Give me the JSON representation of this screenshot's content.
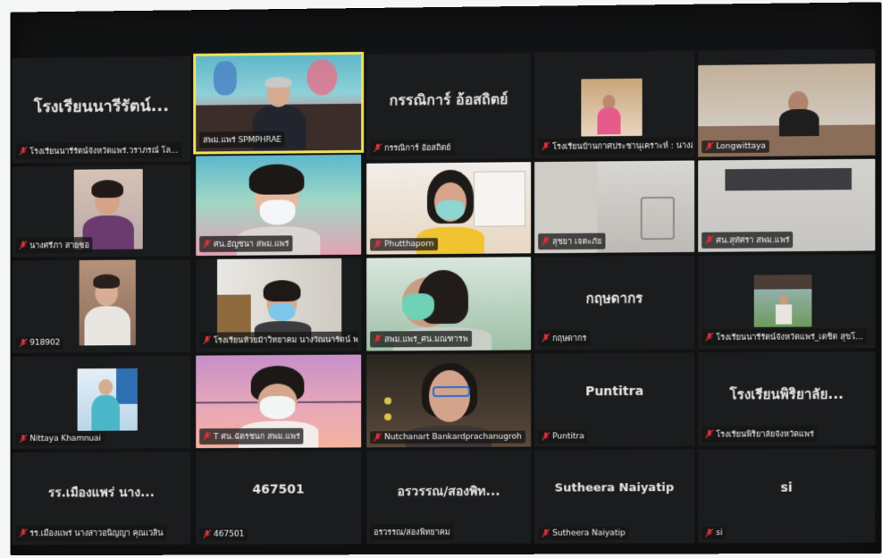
{
  "meeting": {
    "tiles": [
      {
        "id": "t1",
        "display_name": "โรงเรียนนารีรัตน์...",
        "label": "โรงเรียนนารีรัตน์จังหวัดแพร่.วราภรณ์ โล...",
        "muted": true
      },
      {
        "id": "t2",
        "display_name": "",
        "label": "สพม.แพร่ SPMPHRAE",
        "muted": false
      },
      {
        "id": "t3",
        "display_name": "กรรณิการ์ อ้อสถิตย์",
        "label": "กรรณิการ์ อ้อสถิตย์",
        "muted": true
      },
      {
        "id": "t4",
        "display_name": "",
        "label": "โรงเรียนบ้านกาศประชานุเคราะห์ : นางสา...",
        "muted": true
      },
      {
        "id": "t5",
        "display_name": "",
        "label": "Longwittaya",
        "muted": true
      },
      {
        "id": "t6",
        "display_name": "",
        "label": "นางศรีภา สายซอ",
        "muted": true
      },
      {
        "id": "t7",
        "display_name": "",
        "label": "ศน.อัญชนา สพม.แพร่",
        "muted": true
      },
      {
        "id": "t8",
        "display_name": "",
        "label": "Phutthaporn",
        "muted": true
      },
      {
        "id": "t9",
        "display_name": "",
        "label": "สุชยา เจตะภัย",
        "muted": true
      },
      {
        "id": "t10",
        "display_name": "",
        "label": "ศน.สุทัศรา สพม.แพร่",
        "muted": true
      },
      {
        "id": "t11",
        "display_name": "",
        "label": "918902",
        "muted": true
      },
      {
        "id": "t12",
        "display_name": "",
        "label": "โรงเรียนห้วยม้าวิทยาคม นางวัณนารัตน์ พ...",
        "muted": true
      },
      {
        "id": "t13",
        "display_name": "",
        "label": "สพม.แพร่_ศน.มณฑารพ",
        "muted": true
      },
      {
        "id": "t14",
        "display_name": "กฤษดากร",
        "label": "กฤษดากร",
        "muted": true
      },
      {
        "id": "t15",
        "display_name": "",
        "label": "โรงเรียนนารีรัตน์จังหวัดแพร่_เดชิต สุขโ...",
        "muted": true
      },
      {
        "id": "t16",
        "display_name": "",
        "label": "Nittaya Khamnuai",
        "muted": true
      },
      {
        "id": "t17",
        "display_name": "",
        "label": "T ศน.ฉัตรชนก สพม.แพร่",
        "muted": true
      },
      {
        "id": "t18",
        "display_name": "",
        "label": "Nutchanart Bankardprachanugroh",
        "muted": true
      },
      {
        "id": "t19",
        "display_name": "Puntitra",
        "label": "Puntitra",
        "muted": true
      },
      {
        "id": "t20",
        "display_name": "โรงเรียนพิริยาลัย...",
        "label": "โรงเรียนพิริยาลัยจังหวัดแพร่",
        "muted": true
      },
      {
        "id": "t21",
        "display_name": "รร.เมืองแพร่ นาง...",
        "label": "รร.เมืองแพร่ นางสาวอนิญญา คุณเวสิน",
        "muted": true
      },
      {
        "id": "t22",
        "display_name": "467501",
        "label": "467501",
        "muted": true
      },
      {
        "id": "t23",
        "display_name": "อรวรรณ/สองพิท...",
        "label": "อรวรรณ/สองพิทยาคม",
        "muted": false
      },
      {
        "id": "t24",
        "display_name": "Sutheera Naiyatip",
        "label": "Sutheera Naiyatip",
        "muted": true
      },
      {
        "id": "t25",
        "display_name": "si",
        "label": "si",
        "muted": true
      }
    ]
  },
  "colors": {
    "muted_icon": "#e0333b",
    "active_speaker": "#f0e35a",
    "tile_bg": "#1b1c1e"
  }
}
